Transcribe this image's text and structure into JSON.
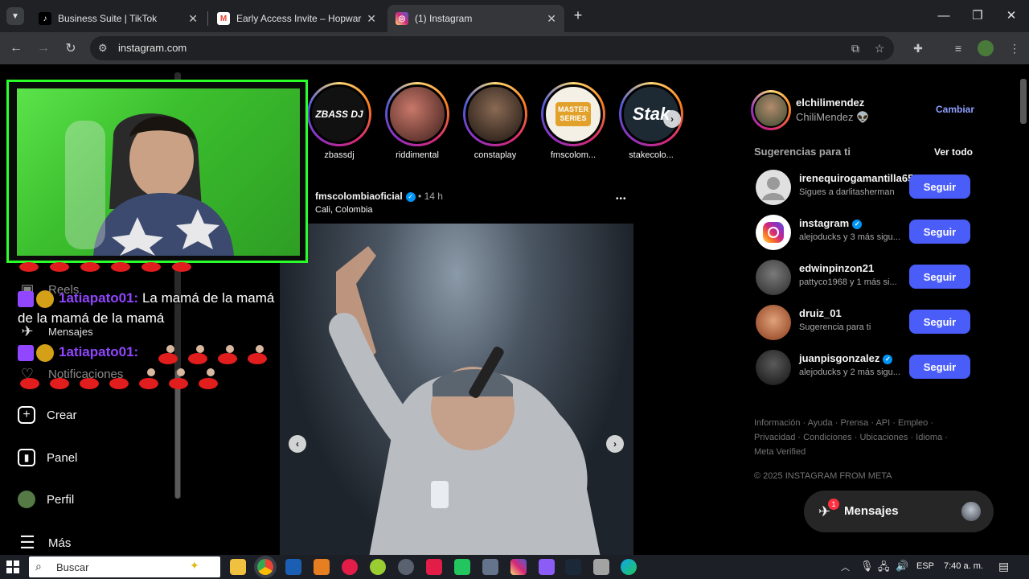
{
  "browser": {
    "tabs": [
      {
        "title": "Business Suite | TikTok",
        "favicon": "tiktok-icon",
        "active": false
      },
      {
        "title": "Early Access Invite – Hopward I",
        "favicon": "gmail-icon",
        "active": false
      },
      {
        "title": "(1) Instagram",
        "favicon": "instagram-icon",
        "active": true
      }
    ],
    "new_tab_label": "+",
    "url": "instagram.com"
  },
  "left_nav": {
    "items": [
      {
        "label": "Reels",
        "icon": "reels-icon"
      },
      {
        "label": "Mensajes",
        "icon": "messenger-icon"
      },
      {
        "label": "Notificaciones",
        "icon": "heart-icon"
      },
      {
        "label": "Crear",
        "icon": "plus-square-icon"
      },
      {
        "label": "Panel",
        "icon": "chart-icon"
      },
      {
        "label": "Perfil",
        "icon": "avatar-icon"
      },
      {
        "label": "Más",
        "icon": "menu-icon"
      }
    ]
  },
  "stories": [
    {
      "name": "zbassdj",
      "avatar_text": "ZBASS DJ"
    },
    {
      "name": "riddimental",
      "avatar_text": ""
    },
    {
      "name": "constaplay",
      "avatar_text": ""
    },
    {
      "name": "fmscolom...",
      "avatar_text": "MASTER SERIES"
    },
    {
      "name": "stakecolo...",
      "avatar_text": "Stak"
    }
  ],
  "post": {
    "username": "fmscolombiaoficial",
    "time": "14 h",
    "separator": "•",
    "location": "Cali, Colombia",
    "more": "•••"
  },
  "account": {
    "username": "elchilimendez",
    "display_name": "ChiliMendez 👽",
    "switch_label": "Cambiar"
  },
  "suggestions": {
    "heading": "Sugerencias para ti",
    "see_all": "Ver todo",
    "follow_label": "Seguir",
    "items": [
      {
        "username": "irenequirogamantilla65",
        "sub": "Sigues a darlitasherman",
        "verified": false
      },
      {
        "username": "instagram",
        "sub": "alejoducks y 3 más sigu...",
        "verified": true
      },
      {
        "username": "edwinpinzon21",
        "sub": "pattyco1968 y 1 más si...",
        "verified": false
      },
      {
        "username": "druiz_01",
        "sub": "Sugerencia para ti",
        "verified": false
      },
      {
        "username": "juanpisgonzalez",
        "sub": "alejoducks y 2 más sigu...",
        "verified": true
      }
    ]
  },
  "footer": {
    "links": [
      "Información",
      "Ayuda",
      "Prensa",
      "API",
      "Empleo",
      "Privacidad",
      "Condiciones",
      "Ubicaciones",
      "Idioma",
      "Meta Verified"
    ],
    "copyright": "© 2025 INSTAGRAM FROM META"
  },
  "messages_bar": {
    "label": "Mensajes",
    "badge": "1"
  },
  "chat": [
    {
      "user": "1atiapato01:",
      "message": "La mamá de la mamá de la mamá de la mamá"
    },
    {
      "user": "1atiapato01:",
      "message": ""
    }
  ],
  "taskbar": {
    "search_placeholder": "Buscar",
    "lang": "ESP",
    "time": "7:40 a. m."
  },
  "colors": {
    "accent": "#4a5df9",
    "twitch": "#9146ff",
    "webcam_border": "#2aff2a"
  }
}
